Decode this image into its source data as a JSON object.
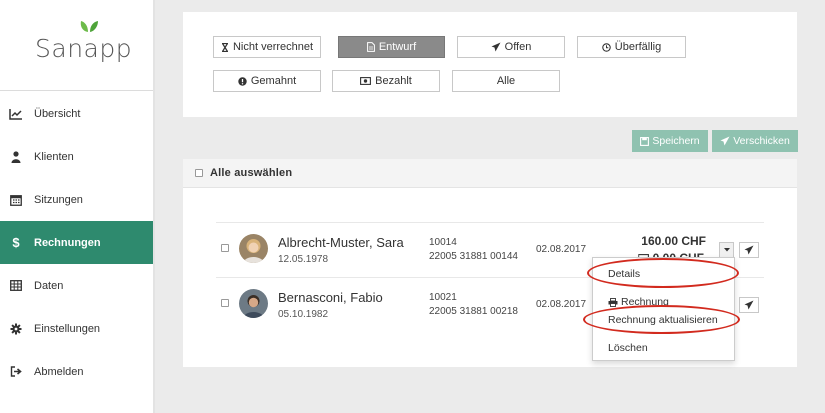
{
  "app": {
    "logo_text": "Sanapp"
  },
  "sidebar": {
    "items": [
      {
        "label": "Übersicht",
        "icon": "chart-line-icon"
      },
      {
        "label": "Klienten",
        "icon": "user-icon"
      },
      {
        "label": "Sitzungen",
        "icon": "calendar-icon"
      },
      {
        "label": "Rechnungen",
        "icon": "dollar-icon",
        "active": true
      },
      {
        "label": "Daten",
        "icon": "table-icon"
      },
      {
        "label": "Einstellungen",
        "icon": "gear-icon"
      },
      {
        "label": "Abmelden",
        "icon": "sign-out-icon"
      }
    ],
    "active_color": "#2e8a6e"
  },
  "filters": [
    {
      "label": "Nicht verrechnet",
      "icon": "hourglass-icon"
    },
    {
      "label": "Entwurf",
      "icon": "file-icon",
      "active": true
    },
    {
      "label": "Offen",
      "icon": "paper-plane-icon"
    },
    {
      "label": "Überfällig",
      "icon": "clock-icon"
    },
    {
      "label": "Gemahnt",
      "icon": "exclamation-circle-icon"
    },
    {
      "label": "Bezahlt",
      "icon": "money-icon"
    },
    {
      "label": "Alle",
      "icon": ""
    }
  ],
  "actions": {
    "save_label": "Speichern",
    "send_label": "Verschicken",
    "color": "#8fc2b0"
  },
  "list": {
    "select_all_label": "Alle auswählen",
    "rows": [
      {
        "name": "Albrecht-Muster, Sara",
        "dob": "12.05.1978",
        "number": "10014",
        "reference": "22005 31881 00144",
        "date": "02.08.2017",
        "amount": "160.00 CHF",
        "amount_paid": "0.00 CHF"
      },
      {
        "name": "Bernasconi, Fabio",
        "dob": "05.10.1982",
        "number": "10021",
        "reference": "22005 31881 00218",
        "date": "02.08.2017"
      }
    ]
  },
  "menu": {
    "items": [
      {
        "label": "Details"
      },
      {
        "label": "Rechnung",
        "icon": "print-icon"
      },
      {
        "label": "Rechnung aktualisieren"
      },
      {
        "label": "Löschen"
      }
    ],
    "highlight_color": "#d22a1e"
  }
}
